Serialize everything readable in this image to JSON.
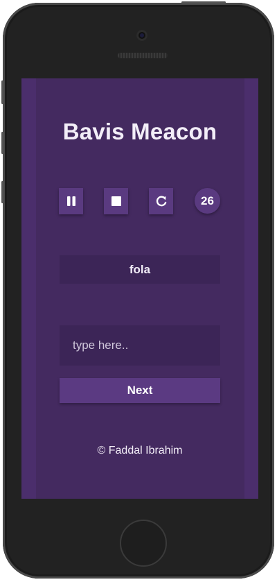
{
  "app": {
    "title": "Bavis Meacon",
    "controls": {
      "pause_icon": "pause-icon",
      "stop_icon": "stop-icon",
      "restart_icon": "refresh-icon",
      "counter": "26"
    },
    "word": "fola",
    "input": {
      "placeholder": "type here..",
      "value": ""
    },
    "next_label": "Next",
    "footer": "© Faddal Ibrahim"
  },
  "colors": {
    "screen_bg": "#4b2e6c",
    "panel_bg": "#442a60",
    "field_bg": "#3c2557",
    "button_bg": "#5a3a80",
    "text": "#f3eef8"
  }
}
